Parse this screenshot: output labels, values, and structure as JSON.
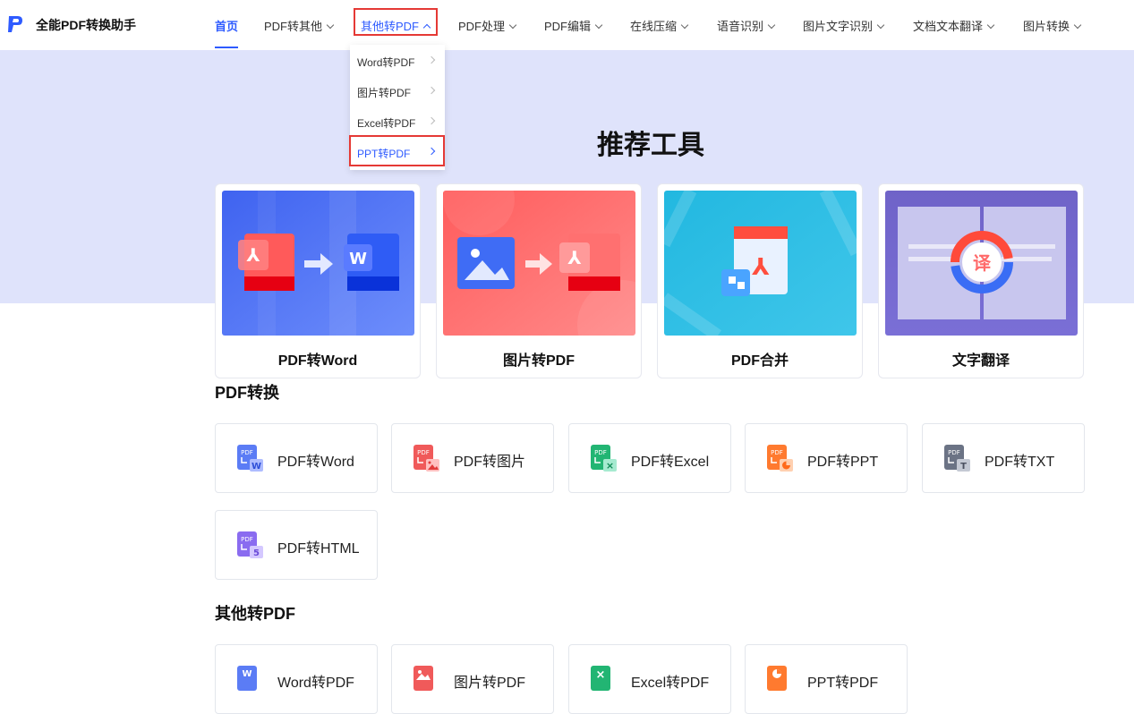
{
  "app": {
    "name": "全能PDF转换助手"
  },
  "nav": {
    "items": [
      {
        "label": "首页"
      },
      {
        "label": "PDF转其他"
      },
      {
        "label": "其他转PDF"
      },
      {
        "label": "PDF处理"
      },
      {
        "label": "PDF编辑"
      },
      {
        "label": "在线压缩"
      },
      {
        "label": "语音识别"
      },
      {
        "label": "图片文字识别"
      },
      {
        "label": "文档文本翻译"
      },
      {
        "label": "图片转换"
      }
    ]
  },
  "dropdown": {
    "items": [
      {
        "label": "Word转PDF"
      },
      {
        "label": "图片转PDF"
      },
      {
        "label": "Excel转PDF"
      },
      {
        "label": "PPT转PDF"
      }
    ]
  },
  "recommended": {
    "title": "推荐工具",
    "cards": [
      {
        "label": "PDF转Word"
      },
      {
        "label": "图片转PDF"
      },
      {
        "label": "PDF合并"
      },
      {
        "label": "文字翻译"
      }
    ]
  },
  "pdf_convert": {
    "title": "PDF转换",
    "tools": [
      {
        "label": "PDF转Word",
        "color": "#5b7cf5",
        "badge": "W"
      },
      {
        "label": "PDF转图片",
        "color": "#f05a5a",
        "badge": "img"
      },
      {
        "label": "PDF转Excel",
        "color": "#22b573",
        "badge": "X"
      },
      {
        "label": "PDF转PPT",
        "color": "#ff7a2f",
        "badge": "P"
      },
      {
        "label": "PDF转TXT",
        "color": "#6b7385",
        "badge": "T"
      },
      {
        "label": "PDF转HTML",
        "color": "#8a6cf0",
        "badge": "5"
      }
    ]
  },
  "other_to_pdf": {
    "title": "其他转PDF",
    "tools": [
      {
        "label": "Word转PDF",
        "color": "#5b7cf5"
      },
      {
        "label": "图片转PDF",
        "color": "#f05a5a"
      },
      {
        "label": "Excel转PDF",
        "color": "#22b573"
      },
      {
        "label": "PPT转PDF",
        "color": "#ff7a2f"
      }
    ]
  },
  "icon_text": {
    "pdf": "PDF",
    "translate": "译"
  }
}
